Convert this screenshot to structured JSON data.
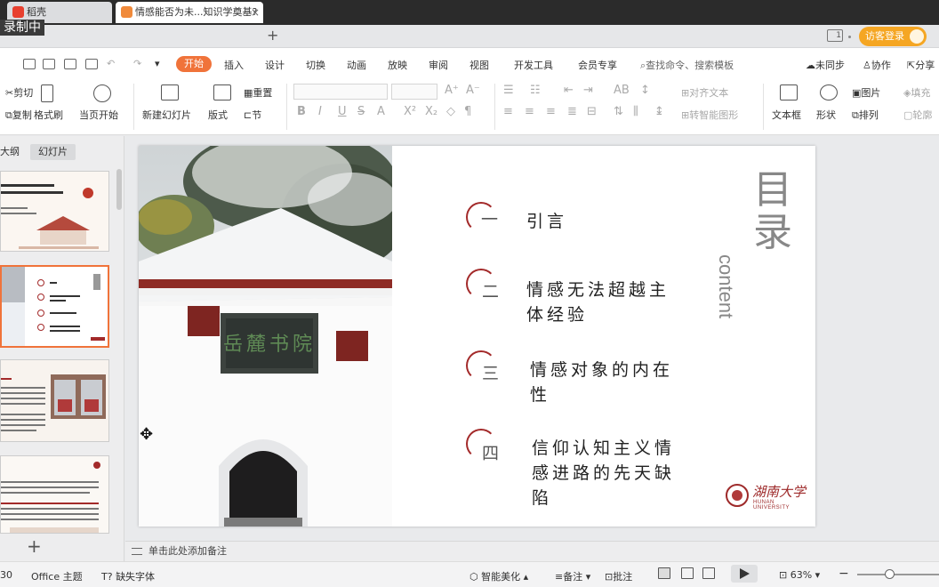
{
  "recording_badge": "录制中",
  "tabs": [
    {
      "label": "稻壳"
    },
    {
      "label": "情感能否为未...知识学奠基?"
    }
  ],
  "new_tab": "+",
  "login_label": "访客登录",
  "menu": {
    "start": "开始",
    "items": [
      "插入",
      "设计",
      "切换",
      "动画",
      "放映",
      "审阅",
      "视图",
      "开发工具",
      "会员专享"
    ],
    "search": "查找命令、搜索模板",
    "sync": "未同步",
    "collab": "协作",
    "share": "分享"
  },
  "ribbon": {
    "cut": "剪切",
    "copy": "复制",
    "format_painter": "格式刷",
    "play_from_current": "当页开始",
    "new_slide": "新建幻灯片",
    "layout": "版式",
    "reset": "重置",
    "section": "节",
    "align_text": "对齐文本",
    "to_smartart": "转智能图形",
    "textbox": "文本框",
    "shape": "形状",
    "picture": "图片",
    "arrange": "排列",
    "fill": "填充",
    "outline": "轮廓"
  },
  "panel": {
    "outline_tab": "大纲",
    "slides_tab": "幻灯片",
    "add": "+"
  },
  "slide": {
    "title_cn": "目录",
    "title_en": "content",
    "items": [
      {
        "num": "一",
        "text": "引言"
      },
      {
        "num": "二",
        "text": "情感无法超越主体经验"
      },
      {
        "num": "三",
        "text": "情感对象的内在性"
      },
      {
        "num": "四",
        "text": "信仰认知主义情感进路的先天缺陷"
      }
    ],
    "logo_name": "湖南大学",
    "logo_sub": "HUNAN UNIVERSITY",
    "plaque": "岳麓书院"
  },
  "notes_placeholder": "单击此处添加备注",
  "status": {
    "slide_count": "30",
    "theme": "Office 主题",
    "missing_font": "缺失字体",
    "beautify": "智能美化",
    "notes": "备注",
    "comments": "批注",
    "zoom": "63%"
  },
  "colors": {
    "accent": "#f0733a",
    "login": "#f5a623",
    "toc_red": "#a32a2a"
  }
}
